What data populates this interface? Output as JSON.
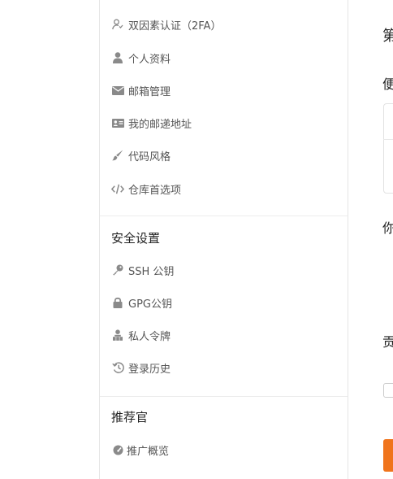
{
  "sidebar": {
    "account_items": [
      {
        "label": "双因素认证（2FA）",
        "icon": "user-shield-icon"
      },
      {
        "label": "个人资料",
        "icon": "user-icon"
      },
      {
        "label": "邮箱管理",
        "icon": "envelope-icon"
      },
      {
        "label": "我的邮递地址",
        "icon": "address-card-icon"
      },
      {
        "label": "代码风格",
        "icon": "brush-icon"
      },
      {
        "label": "仓库首选项",
        "icon": "code-icon"
      }
    ],
    "security": {
      "title": "安全设置",
      "items": [
        {
          "label": "SSH 公钥",
          "icon": "key-icon"
        },
        {
          "label": "GPG公钥",
          "icon": "lock-icon"
        },
        {
          "label": "私人令牌",
          "icon": "token-icon"
        },
        {
          "label": "登录历史",
          "icon": "history-icon"
        }
      ]
    },
    "referral": {
      "title": "推荐官",
      "items": [
        {
          "label": "推广概览",
          "icon": "dashboard-icon"
        }
      ]
    }
  },
  "main": {
    "heading_1": "第",
    "heading_2": "便",
    "heading_3": "你",
    "heading_4": "贡"
  },
  "colors": {
    "accent": "#f0741c",
    "icon": "#8a8a8a",
    "text": "#555555",
    "title": "#222222"
  }
}
